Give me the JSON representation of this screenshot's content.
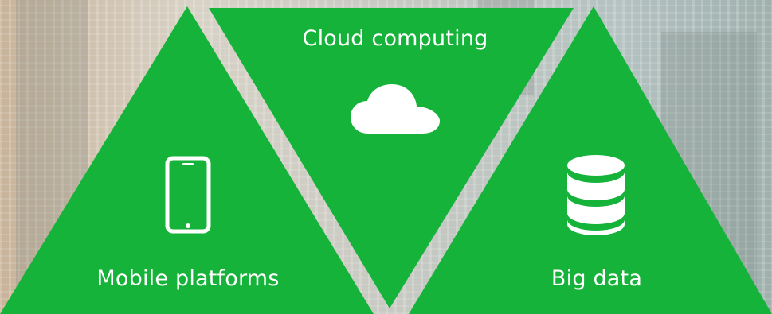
{
  "segments": [
    {
      "label": "Mobile platforms",
      "icon": "smartphone-icon"
    },
    {
      "label": "Cloud computing",
      "icon": "cloud-icon"
    },
    {
      "label": "Big data",
      "icon": "database-icon"
    }
  ],
  "colors": {
    "accent": "#16b33a",
    "icon": "#ffffff"
  }
}
